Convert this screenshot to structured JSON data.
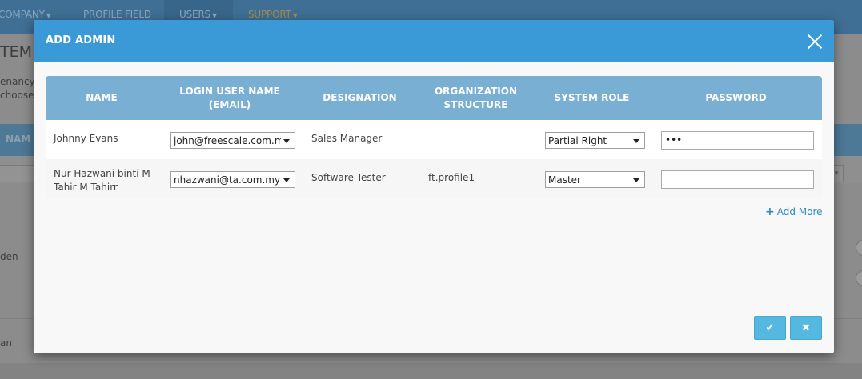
{
  "nav": {
    "items": [
      {
        "label": "COMPANY",
        "caret": true
      },
      {
        "label": "PROFILE FIELD",
        "caret": false
      },
      {
        "label": "USERS",
        "caret": true
      },
      {
        "label": "SUPPORT",
        "caret": true
      }
    ]
  },
  "background": {
    "title": "TEM",
    "desc_line1": "enancy",
    "desc_line2": "choose",
    "table_header": "NAM",
    "row1_text": "den",
    "row2_text": "an"
  },
  "modal": {
    "title": "ADD ADMIN",
    "columns": [
      "NAME",
      "LOGIN USER NAME (EMAIL)",
      "DESIGNATION",
      "ORGANIZATION STRUCTURE",
      "SYSTEM ROLE",
      "PASSWORD"
    ],
    "rows": [
      {
        "name": "Johnny Evans",
        "email": "john@freescale.com.my",
        "designation": "Sales Manager",
        "org_structure": "",
        "system_role": "Partial Right_",
        "password": "•••"
      },
      {
        "name": "Nur Hazwani binti M Tahir M Tahirr",
        "email": "nhazwani@ta.com.my",
        "designation": "Software Tester",
        "org_structure": "ft.profile1",
        "system_role": "Master",
        "password": ""
      }
    ],
    "add_more_label": "Add More",
    "colors": {
      "header": "#3a9ad8",
      "table_header": "#7aafd4",
      "button": "#55b8de",
      "link": "#2f87c6"
    }
  }
}
